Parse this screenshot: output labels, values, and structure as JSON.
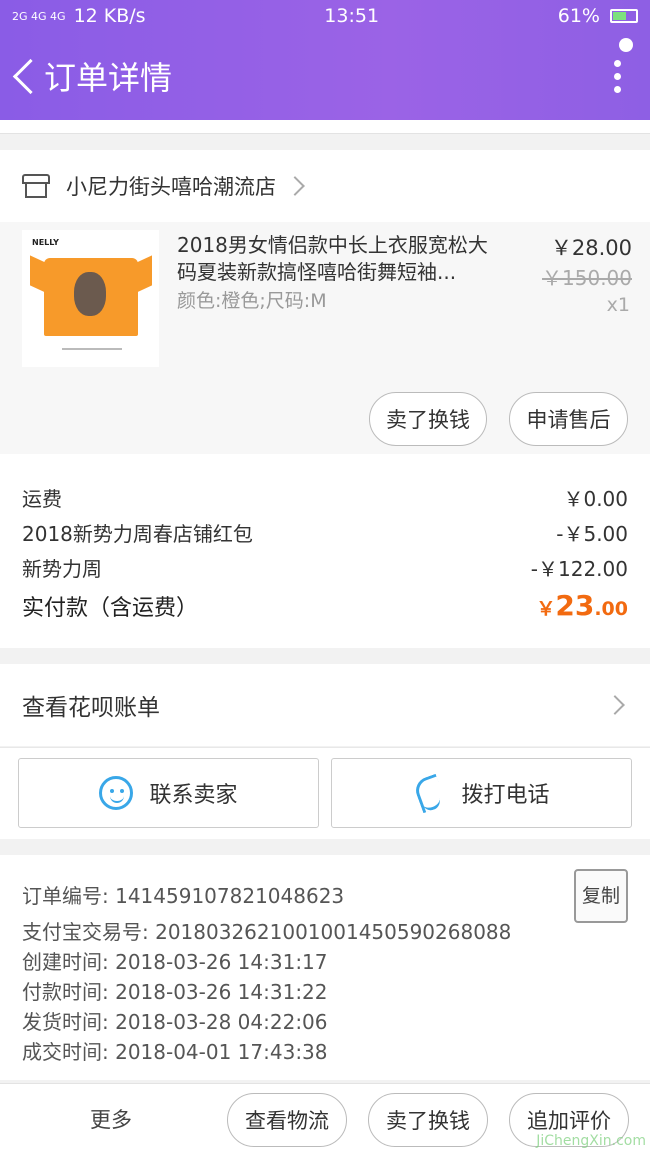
{
  "status_bar": {
    "signal": "2G 4G 4G",
    "net_speed": "12 KB/s",
    "time": "13:51",
    "battery_percent": "61%",
    "battery_level": 0.61
  },
  "header": {
    "title": "订单详情"
  },
  "shop": {
    "name": "小尼力街头嘻哈潮流店"
  },
  "item": {
    "title": "2018男女情侣款中长上衣服宽松大码夏装新款搞怪嘻哈街舞短袖...",
    "spec": "颜色:橙色;尺码:M",
    "price": "￥28.00",
    "original_price": "￥150.00",
    "quantity": "x1",
    "image_brand": "NELLY",
    "actions": {
      "sell": "卖了换钱",
      "after_sale": "申请售后"
    }
  },
  "fees": {
    "rows": [
      {
        "label": "运费",
        "value": "￥0.00"
      },
      {
        "label": "2018新势力周春店铺红包",
        "value": "-￥5.00"
      },
      {
        "label": "新势力周",
        "value": "-￥122.00"
      }
    ],
    "total_label": "实付款（含运费）",
    "total_currency": "￥",
    "total_int": "23",
    "total_dec": ".00"
  },
  "huabei": {
    "label": "查看花呗账单"
  },
  "contact": {
    "seller": "联系卖家",
    "phone": "拨打电话"
  },
  "order_info": {
    "order_no_label": "订单编号: 141459107821048623",
    "copy_label": "复制",
    "alipay_no": "支付宝交易号: 2018032621001001450590268088",
    "created": "创建时间: 2018-03-26 14:31:17",
    "paid": "付款时间: 2018-03-26 14:31:22",
    "shipped": "发货时间: 2018-03-28 04:22:06",
    "completed": "成交时间: 2018-04-01 17:43:38"
  },
  "bottom_bar": {
    "more": "更多",
    "logistics": "查看物流",
    "sell": "卖了换钱",
    "review": "追加评价"
  },
  "watermark": "JiChengXin.com",
  "colors": {
    "header_gradient_start": "#8a5ce6",
    "accent_orange": "#f26a10",
    "icon_blue": "#39a7e8",
    "product_orange": "#f79a2a"
  },
  "icons": [
    "back-icon",
    "more-icon",
    "shop-icon",
    "chevron-right-icon",
    "chat-icon",
    "phone-icon"
  ]
}
